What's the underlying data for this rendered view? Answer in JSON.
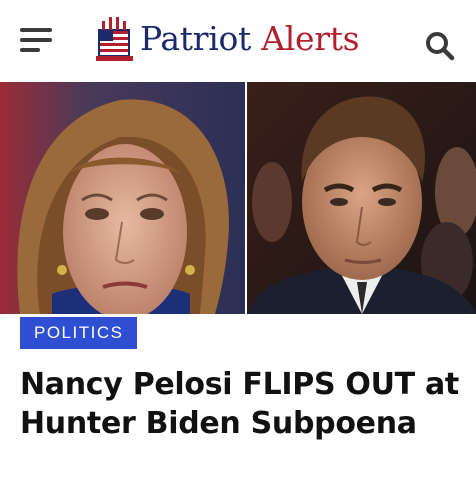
{
  "header": {
    "menu_icon": "hamburger-menu-icon",
    "logo_icon": "capitol-flag-logo-icon",
    "brand_word_1": "Patriot",
    "brand_word_2": "Alerts",
    "search_icon": "search-icon",
    "colors": {
      "brand_blue": "#1b2a6b",
      "brand_red": "#b21f2d"
    }
  },
  "article": {
    "category": "POLITICS",
    "headline": "Nancy Pelosi FLIPS OUT at Hunter Biden Subpoena",
    "colors": {
      "badge": "#2f4fd3"
    }
  }
}
